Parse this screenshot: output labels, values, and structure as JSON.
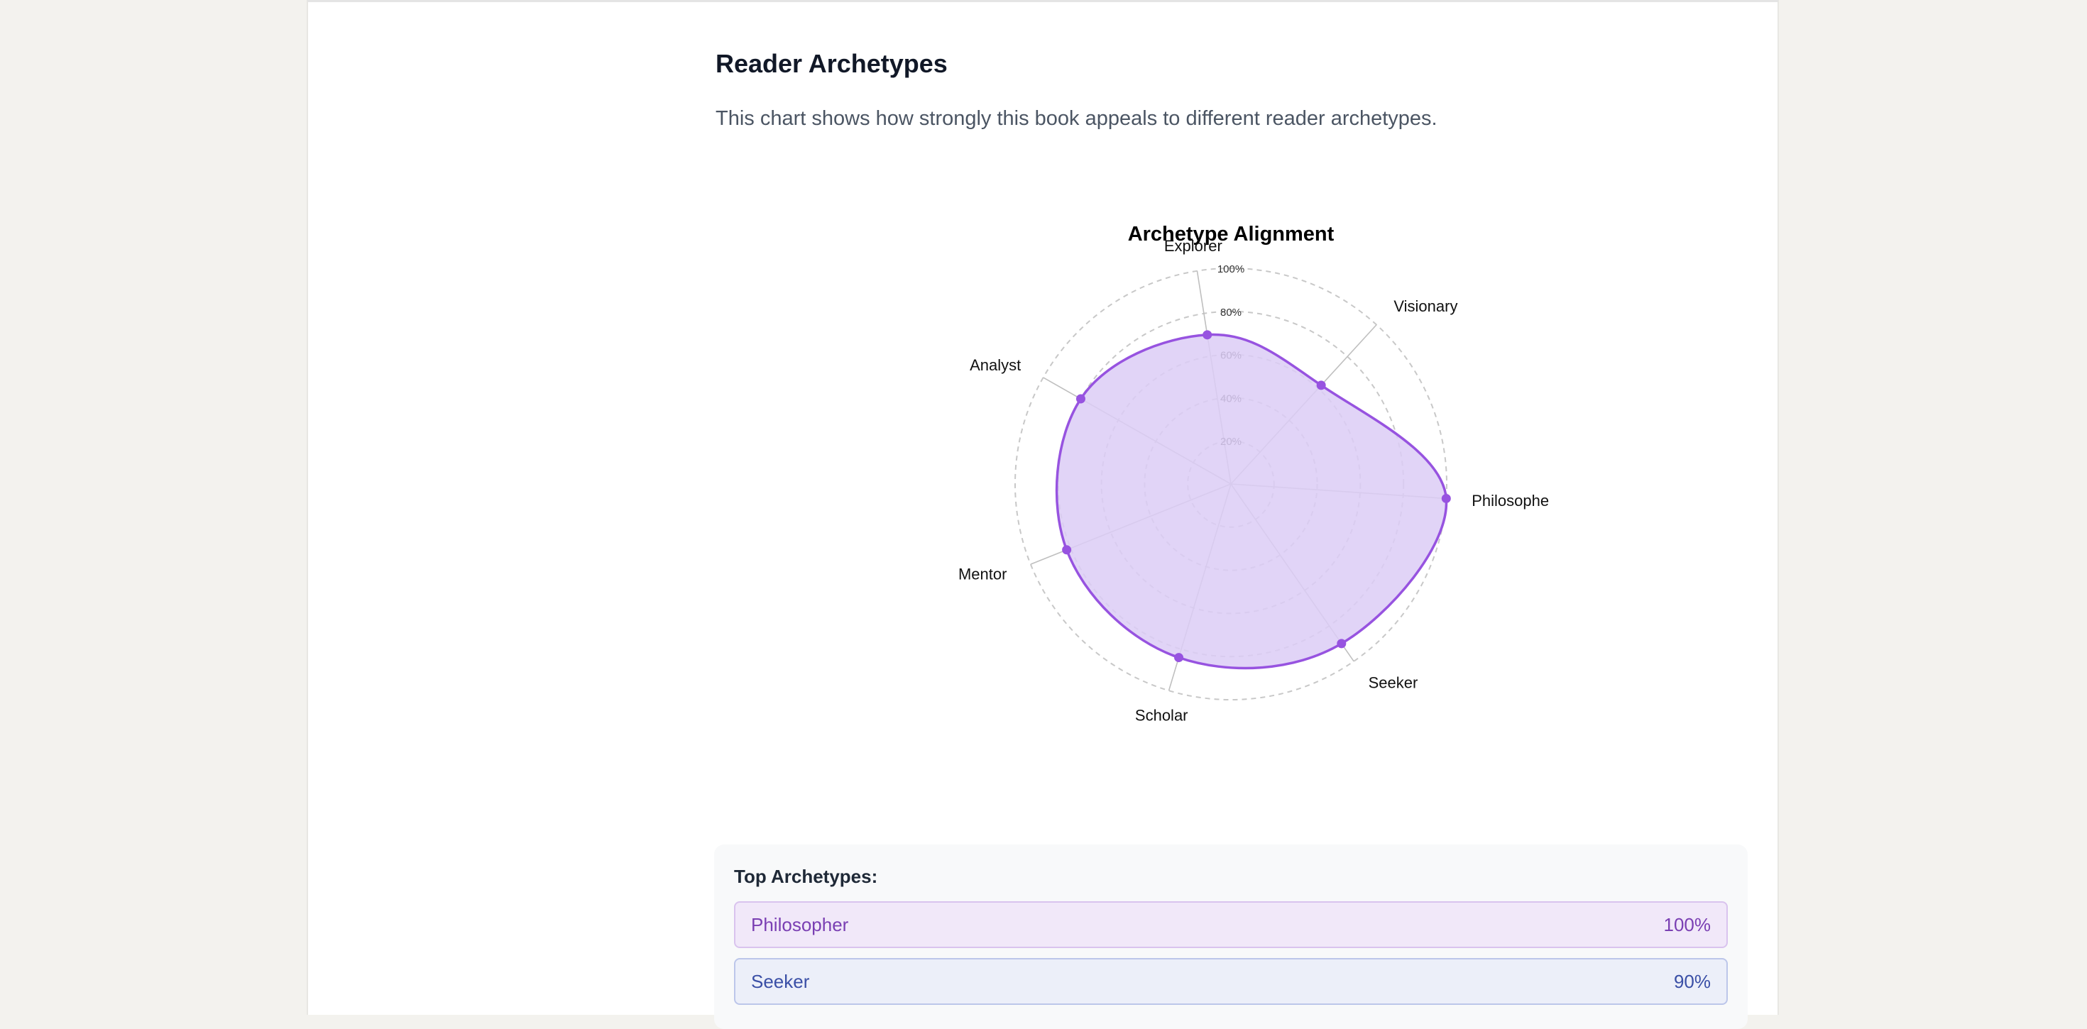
{
  "section": {
    "title": "Reader Archetypes",
    "description": "This chart shows how strongly this book appeals to different reader archetypes."
  },
  "chart_data": {
    "type": "radar",
    "title": "Archetype Alignment",
    "axes": [
      "Explorer",
      "Visionary",
      "Philosophe",
      "Seeker",
      "Scholar",
      "Mentor",
      "Analyst"
    ],
    "values": [
      70,
      62,
      100,
      90,
      84,
      82,
      80
    ],
    "range": [
      0,
      100
    ],
    "ticks": [
      "20%",
      "40%",
      "60%",
      "80%",
      "100%"
    ],
    "grid": true,
    "colors": {
      "stroke": "#9753e0",
      "fill": "#dccdf6",
      "grid": "#c8c8c8",
      "spoke": "#bfbfbf"
    }
  },
  "top_archetypes": {
    "heading": "Top Archetypes:",
    "items": [
      {
        "name": "Philosopher",
        "percent": "100%",
        "bg": "#f1e8f9",
        "border": "#d9c3ee",
        "color": "#7a3fb3"
      },
      {
        "name": "Seeker",
        "percent": "90%",
        "bg": "#eceff9",
        "border": "#bcc6ea",
        "color": "#3a4fa6"
      }
    ]
  }
}
